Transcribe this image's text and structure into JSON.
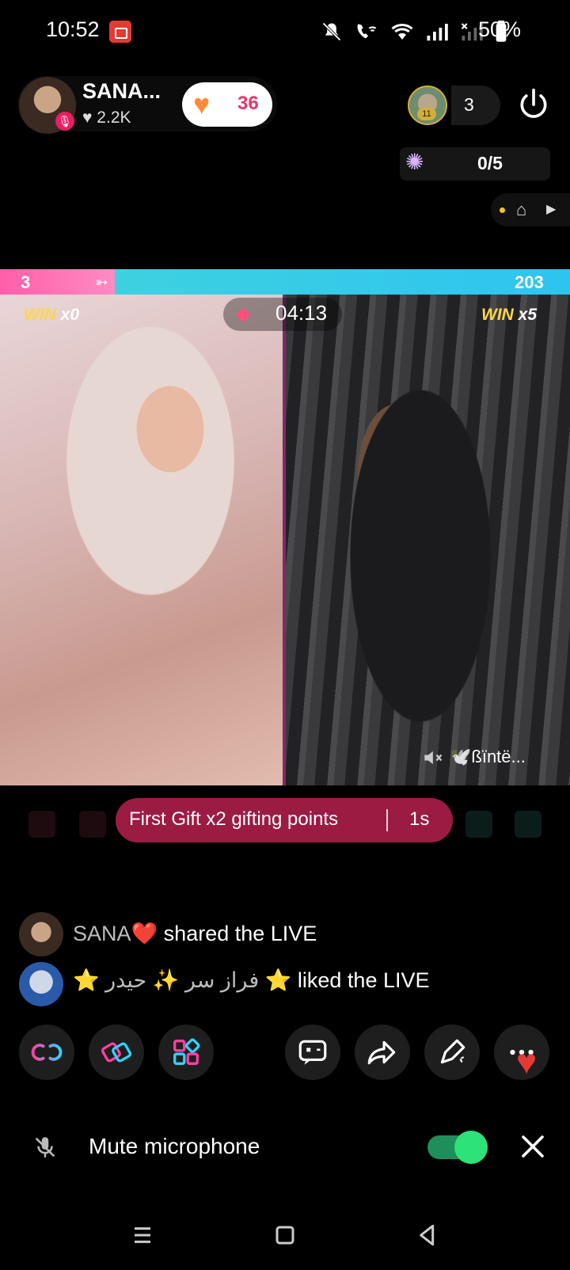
{
  "status_bar": {
    "time": "10:52",
    "battery": "50%",
    "icons": [
      "screen-record-icon",
      "mute-icon",
      "wifi-calling-icon",
      "wifi-icon",
      "signal-icon",
      "signal-no-sim-icon",
      "battery-icon"
    ]
  },
  "host": {
    "name": "SANA...",
    "likes": "♥ 2.2K",
    "follow_count": "36"
  },
  "viewers": {
    "rank": "11",
    "count": "3"
  },
  "fan_club": {
    "progress": "0/5"
  },
  "battle": {
    "left_score": "3",
    "right_score": "203",
    "timer": "04:13",
    "left_win": {
      "word": "WIN",
      "count": "x0"
    },
    "right_win": {
      "word": "WIN",
      "count": "x5"
    },
    "opponent_name": "🕊️ßïntë...",
    "score_colors": {
      "left": "#ff5ea8",
      "right": "#2ec4f0"
    }
  },
  "gift_banner": {
    "text": "First Gift x2 gifting points",
    "timer": "1s"
  },
  "chat": [
    {
      "user": "SANA",
      "emoji": "❤️",
      "action": "shared the LIVE"
    },
    {
      "prefix_star": "⭐",
      "user_part1": "فراز سر",
      "sparkle": "✨",
      "user_part2": "حیدر",
      "suffix_star": "⭐",
      "action": "liked the LIVE"
    }
  ],
  "actions": {
    "left": [
      "link-icon",
      "battle-icon",
      "apps-icon"
    ],
    "right": [
      "chat-icon",
      "share-icon",
      "effects-pen-icon",
      "more-icon"
    ]
  },
  "mic": {
    "label": "Mute microphone",
    "enabled": true
  },
  "nav": [
    "menu-icon",
    "home-icon",
    "back-icon"
  ]
}
